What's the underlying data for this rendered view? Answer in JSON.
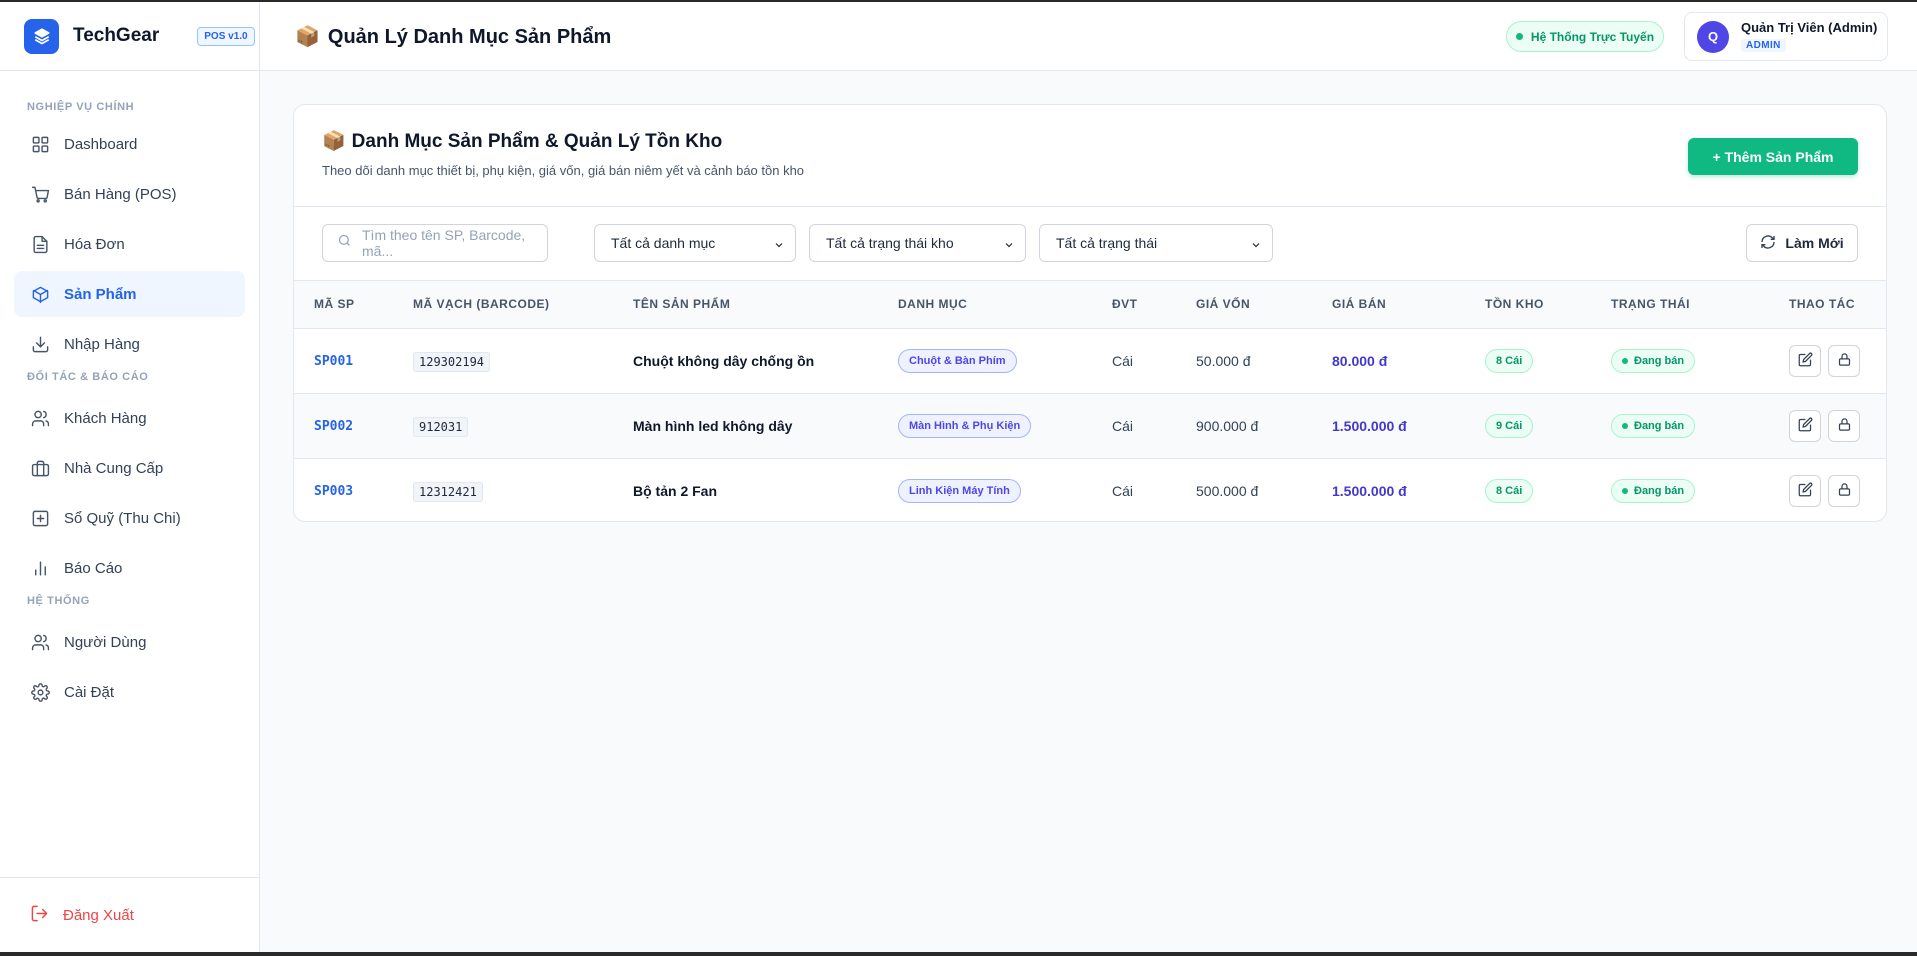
{
  "brand": {
    "name": "TechGear",
    "version": "POS v1.0"
  },
  "sidebar": {
    "sections": [
      {
        "title": "NGHIỆP VỤ CHÍNH"
      },
      {
        "title": "ĐỐI TÁC & BÁO CÁO"
      },
      {
        "title": "HỆ THỐNG"
      }
    ],
    "items": [
      {
        "label": "Dashboard",
        "icon": "grid-icon"
      },
      {
        "label": "Bán Hàng (POS)",
        "icon": "cart-icon"
      },
      {
        "label": "Hóa Đơn",
        "icon": "document-icon"
      },
      {
        "label": "Sản Phẩm",
        "icon": "box-icon",
        "active": true
      },
      {
        "label": "Nhập Hàng",
        "icon": "download-icon"
      },
      {
        "label": "Khách Hàng",
        "icon": "users-icon"
      },
      {
        "label": "Nhà Cung Cấp",
        "icon": "briefcase-icon"
      },
      {
        "label": "Sổ Quỹ (Thu Chi)",
        "icon": "wallet-plus-icon"
      },
      {
        "label": "Báo Cáo",
        "icon": "bar-chart-icon"
      },
      {
        "label": "Người Dùng",
        "icon": "users-icon"
      },
      {
        "label": "Cài Đặt",
        "icon": "gear-icon"
      }
    ],
    "logout_label": "Đăng Xuất"
  },
  "header": {
    "emoji": "📦",
    "title": "Quản Lý Danh Mục Sản Phẩm",
    "status": "Hệ Thống Trực Tuyến",
    "user": {
      "initial": "Q",
      "name": "Quản Trị Viên (Admin)",
      "role": "ADMIN"
    }
  },
  "card": {
    "emoji": "📦",
    "title": "Danh Mục Sản Phẩm & Quản Lý Tồn Kho",
    "subtitle": "Theo dõi danh mục thiết bị, phụ kiện, giá vốn, giá bán niêm yết và cảnh báo tồn kho",
    "add_label": "+ Thêm Sản Phẩm"
  },
  "filters": {
    "search_placeholder": "Tìm theo tên SP, Barcode, mã...",
    "category": "Tất cả danh mục",
    "stock_status": "Tất cả trạng thái kho",
    "status": "Tất cả trạng thái",
    "refresh_label": "Làm Mới"
  },
  "table": {
    "columns": [
      "MÃ SP",
      "MÃ VẠCH (BARCODE)",
      "TÊN SẢN PHẨM",
      "DANH MỤC",
      "ĐVT",
      "GIÁ VỐN",
      "GIÁ BÁN",
      "TỒN KHO",
      "TRẠNG THÁI",
      "THAO TÁC"
    ],
    "rows": [
      {
        "code": "SP001",
        "barcode": "129302194",
        "name": "Chuột không dây chống ồn",
        "category": "Chuột & Bàn Phím",
        "unit": "Cái",
        "cost": "50.000 đ",
        "price": "80.000 đ",
        "stock": "8 Cái",
        "status": "Đang bán"
      },
      {
        "code": "SP002",
        "barcode": "912031",
        "name": "Màn hình led không dây",
        "category": "Màn Hình & Phụ Kiện",
        "unit": "Cái",
        "cost": "900.000 đ",
        "price": "1.500.000 đ",
        "stock": "9 Cái",
        "status": "Đang bán"
      },
      {
        "code": "SP003",
        "barcode": "12312421",
        "name": "Bộ tản 2 Fan",
        "category": "Linh Kiện Máy Tính",
        "unit": "Cái",
        "cost": "500.000 đ",
        "price": "1.500.000 đ",
        "stock": "8 Cái",
        "status": "Đang bán"
      }
    ]
  },
  "colors": {
    "primary": "#2563eb",
    "success": "#10b981",
    "danger": "#ef4444",
    "price": "#4338ca"
  }
}
